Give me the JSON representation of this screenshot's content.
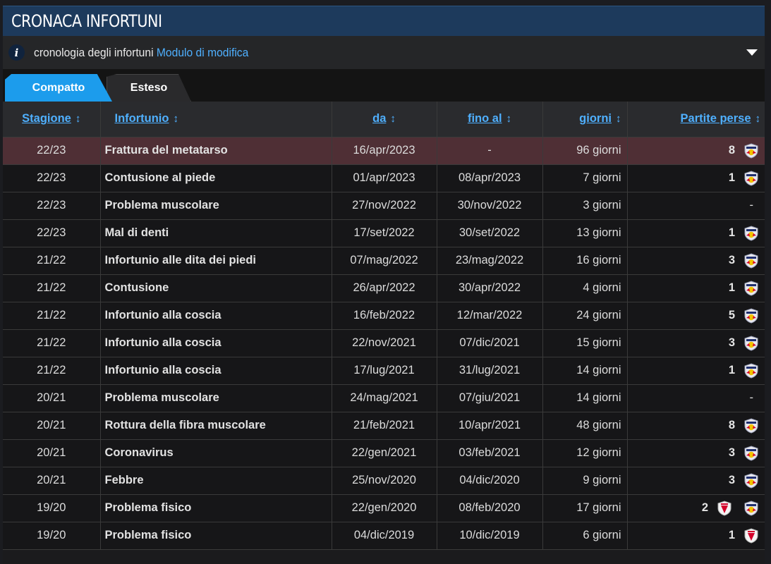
{
  "header": {
    "title": "CRONACA INFORTUNI"
  },
  "infobar": {
    "icon": "info-icon",
    "text": "cronologia degli infortuni",
    "link": "Modulo di modifica"
  },
  "tabs": [
    {
      "label": "Compatto",
      "active": true
    },
    {
      "label": "Esteso",
      "active": false
    }
  ],
  "columns": [
    "Stagione",
    "Infortunio",
    "da",
    "fino al",
    "giorni",
    "Partite perse"
  ],
  "colors": {
    "header_bg": "#1d3a5c",
    "accent": "#1c9cec",
    "link": "#4fb0ff",
    "highlight_row": "#4f2f35"
  },
  "rows": [
    {
      "season": "22/23",
      "injury": "Frattura del metatarso",
      "from": "16/apr/2023",
      "until": "-",
      "days": "96 giorni",
      "games": [
        {
          "count": "8",
          "club": "salzburg"
        }
      ]
    },
    {
      "season": "22/23",
      "injury": "Contusione al piede",
      "from": "01/apr/2023",
      "until": "08/apr/2023",
      "days": "7 giorni",
      "games": [
        {
          "count": "1",
          "club": "salzburg"
        }
      ]
    },
    {
      "season": "22/23",
      "injury": "Problema muscolare",
      "from": "27/nov/2022",
      "until": "30/nov/2022",
      "days": "3 giorni",
      "games": []
    },
    {
      "season": "22/23",
      "injury": "Mal di denti",
      "from": "17/set/2022",
      "until": "30/set/2022",
      "days": "13 giorni",
      "games": [
        {
          "count": "1",
          "club": "salzburg"
        }
      ]
    },
    {
      "season": "21/22",
      "injury": "Infortunio alle dita dei piedi",
      "from": "07/mag/2022",
      "until": "23/mag/2022",
      "days": "16 giorni",
      "games": [
        {
          "count": "3",
          "club": "salzburg"
        }
      ]
    },
    {
      "season": "21/22",
      "injury": "Contusione",
      "from": "26/apr/2022",
      "until": "30/apr/2022",
      "days": "4 giorni",
      "games": [
        {
          "count": "1",
          "club": "salzburg"
        }
      ]
    },
    {
      "season": "21/22",
      "injury": "Infortunio alla coscia",
      "from": "16/feb/2022",
      "until": "12/mar/2022",
      "days": "24 giorni",
      "games": [
        {
          "count": "5",
          "club": "salzburg"
        }
      ]
    },
    {
      "season": "21/22",
      "injury": "Infortunio alla coscia",
      "from": "22/nov/2021",
      "until": "07/dic/2021",
      "days": "15 giorni",
      "games": [
        {
          "count": "3",
          "club": "salzburg"
        }
      ]
    },
    {
      "season": "21/22",
      "injury": "Infortunio alla coscia",
      "from": "17/lug/2021",
      "until": "31/lug/2021",
      "days": "14 giorni",
      "games": [
        {
          "count": "1",
          "club": "salzburg"
        }
      ]
    },
    {
      "season": "20/21",
      "injury": "Problema muscolare",
      "from": "24/mag/2021",
      "until": "07/giu/2021",
      "days": "14 giorni",
      "games": []
    },
    {
      "season": "20/21",
      "injury": "Rottura della fibra muscolare",
      "from": "21/feb/2021",
      "until": "10/apr/2021",
      "days": "48 giorni",
      "games": [
        {
          "count": "8",
          "club": "salzburg"
        }
      ]
    },
    {
      "season": "20/21",
      "injury": "Coronavirus",
      "from": "22/gen/2021",
      "until": "03/feb/2021",
      "days": "12 giorni",
      "games": [
        {
          "count": "3",
          "club": "salzburg"
        }
      ]
    },
    {
      "season": "20/21",
      "injury": "Febbre",
      "from": "25/nov/2020",
      "until": "04/dic/2020",
      "days": "9 giorni",
      "games": [
        {
          "count": "3",
          "club": "salzburg"
        }
      ]
    },
    {
      "season": "19/20",
      "injury": "Problema fisico",
      "from": "22/gen/2020",
      "until": "08/feb/2020",
      "days": "17 giorni",
      "games": [
        {
          "count": "2",
          "club": "liefering"
        },
        {
          "count": "",
          "club": "salzburg"
        }
      ]
    },
    {
      "season": "19/20",
      "injury": "Problema fisico",
      "from": "04/dic/2019",
      "until": "10/dic/2019",
      "days": "6 giorni",
      "games": [
        {
          "count": "1",
          "club": "liefering"
        }
      ]
    }
  ]
}
